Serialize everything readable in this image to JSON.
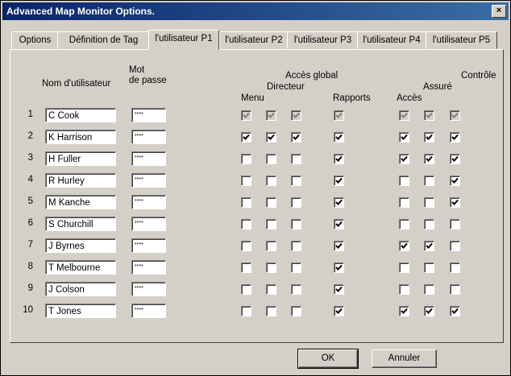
{
  "window": {
    "title": "Advanced Map Monitor Options.",
    "close_label": "×"
  },
  "tabs": [
    {
      "label": "Options"
    },
    {
      "label": "Définition de Tag"
    },
    {
      "label": "l'utilisateur P1"
    },
    {
      "label": "l'utilisateur P2"
    },
    {
      "label": "l'utilisateur P3"
    },
    {
      "label": "l'utilisateur P4"
    },
    {
      "label": "l'utilisateur P5"
    }
  ],
  "active_tab": "l'utilisateur P1",
  "headers": {
    "username": "Nom d'utilisateur",
    "password_line1": "Mot",
    "password_line2": "de passe",
    "global_access": "Accès global",
    "director": "Directeur",
    "menu": "Menu",
    "reports": "Rapports",
    "control": "Contrôle",
    "assured": "Assuré",
    "access": "Accès"
  },
  "users": [
    {
      "num": "1",
      "name": "C Cook",
      "password": "****",
      "disabled": true,
      "checks": [
        1,
        1,
        1,
        1,
        1,
        1,
        1
      ]
    },
    {
      "num": "2",
      "name": "K Harrison",
      "password": "****",
      "disabled": false,
      "checks": [
        1,
        1,
        1,
        1,
        1,
        1,
        1
      ]
    },
    {
      "num": "3",
      "name": "H Fuller",
      "password": "****",
      "disabled": false,
      "checks": [
        0,
        0,
        0,
        1,
        1,
        1,
        1
      ]
    },
    {
      "num": "4",
      "name": "R Hurley",
      "password": "****",
      "disabled": false,
      "checks": [
        0,
        0,
        0,
        1,
        0,
        0,
        1
      ]
    },
    {
      "num": "5",
      "name": "M Kanche",
      "password": "****",
      "disabled": false,
      "checks": [
        0,
        0,
        0,
        1,
        0,
        0,
        1
      ]
    },
    {
      "num": "6",
      "name": "S Churchill",
      "password": "****",
      "disabled": false,
      "checks": [
        0,
        0,
        0,
        1,
        0,
        0,
        0
      ]
    },
    {
      "num": "7",
      "name": "J Byrnes",
      "password": "****",
      "disabled": false,
      "checks": [
        0,
        0,
        0,
        1,
        1,
        1,
        0
      ]
    },
    {
      "num": "8",
      "name": "T Melbourne",
      "password": "****",
      "disabled": false,
      "checks": [
        0,
        0,
        0,
        1,
        0,
        0,
        0
      ]
    },
    {
      "num": "9",
      "name": "J Colson",
      "password": "****",
      "disabled": false,
      "checks": [
        0,
        0,
        0,
        1,
        0,
        0,
        0
      ]
    },
    {
      "num": "10",
      "name": "T Jones",
      "password": "****",
      "disabled": false,
      "checks": [
        0,
        0,
        0,
        1,
        1,
        1,
        1
      ]
    }
  ],
  "buttons": {
    "ok": "OK",
    "cancel": "Annuler"
  }
}
